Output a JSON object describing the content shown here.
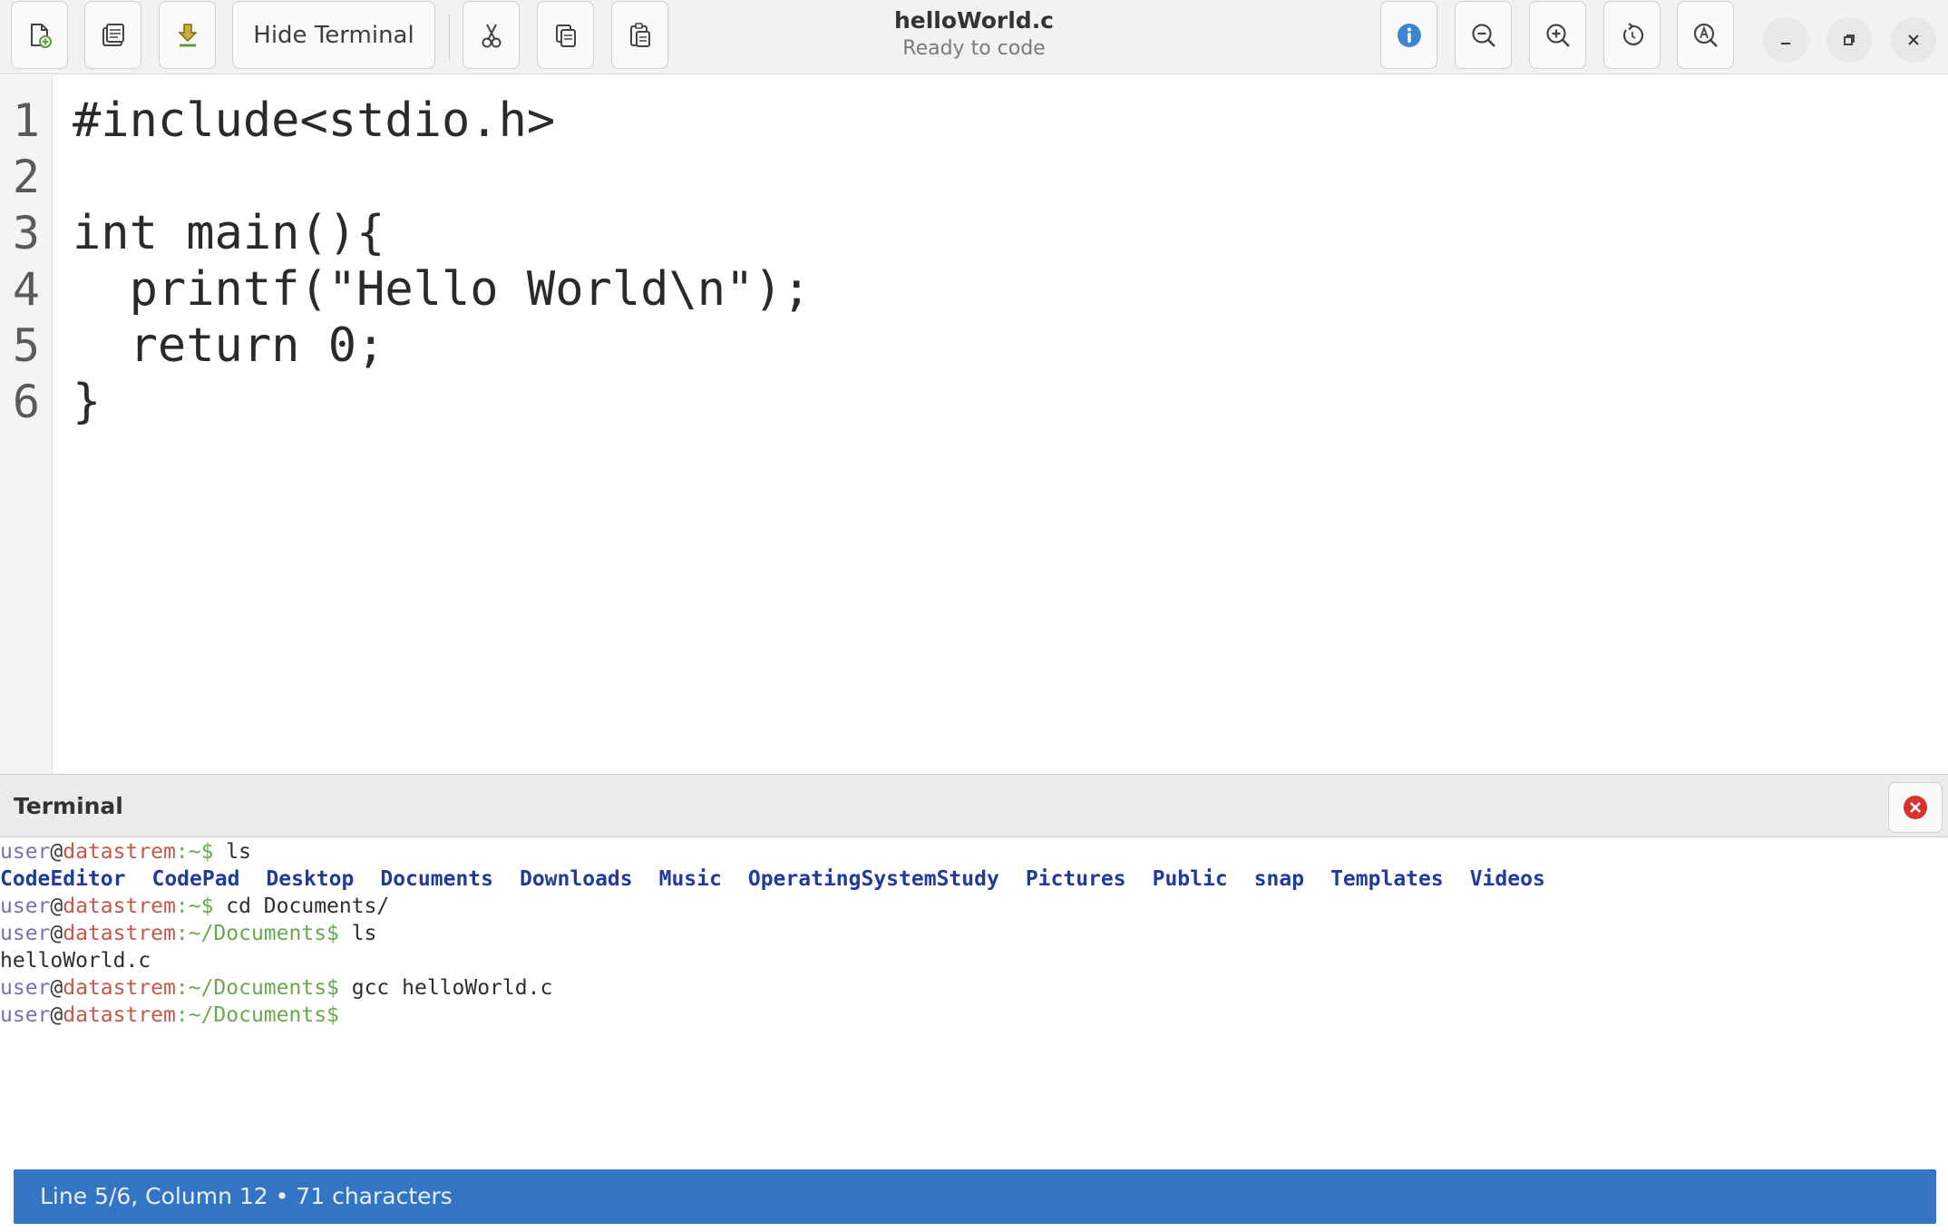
{
  "header": {
    "title": "helloWorld.c",
    "subtitle": "Ready to code",
    "hide_terminal_label": "Hide Terminal",
    "icons": {
      "new_file": "new-file-icon",
      "open_file": "open-file-icon",
      "save_file": "save-download-icon",
      "cut": "scissors-icon",
      "copy": "copy-icon",
      "paste": "paste-icon",
      "info": "info-icon",
      "zoom_out": "zoom-out-icon",
      "zoom_in": "zoom-in-icon",
      "reset": "reset-icon",
      "find": "find-icon",
      "minimize": "minimize-icon",
      "maximize": "maximize-icon",
      "close": "close-icon"
    },
    "info_color": "#3d86cf"
  },
  "editor": {
    "line_numbers": [
      "1",
      "2",
      "3",
      "4",
      "5",
      "6"
    ],
    "lines": [
      "#include<stdio.h>",
      "",
      "int main(){",
      "  printf(\"Hello World\\n\");",
      "  return 0;",
      "}"
    ]
  },
  "terminal": {
    "title": "Terminal",
    "prompt": {
      "user": "user",
      "at": "@",
      "host": "datastrem",
      "home_path": ":~$",
      "docs_path": ":~/Documents$"
    },
    "commands": {
      "ls": " ls",
      "cd": " cd Documents/",
      "ls2": " ls",
      "gcc": " gcc helloWorld.c"
    },
    "ls_output": [
      "CodeEditor",
      "CodePad",
      "Desktop",
      "Documents",
      "Downloads",
      "Music",
      "OperatingSystemStudy",
      "Pictures",
      "Public",
      "snap",
      "Templates",
      "Videos"
    ],
    "ls2_output": "helloWorld.c",
    "colors": {
      "user": "#7a6fb3",
      "host": "#c5574b",
      "path": "#6aa84f",
      "directory": "#1f3c9a",
      "close_button": "#d9322b"
    }
  },
  "status": {
    "text": "Line 5/6, Column 12 • 71 characters",
    "bar_color": "#3374c4"
  }
}
